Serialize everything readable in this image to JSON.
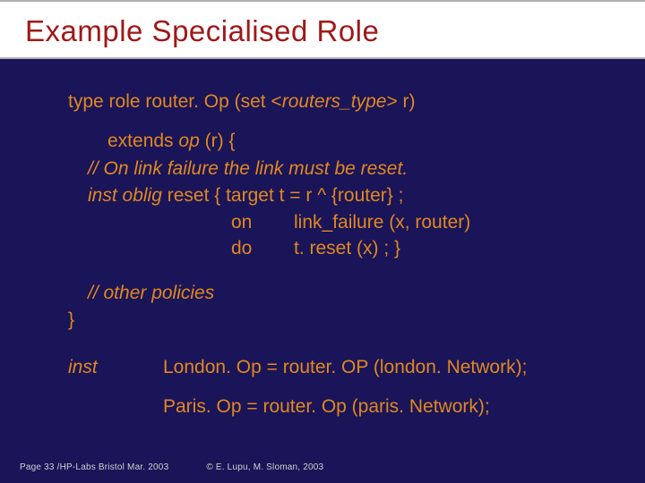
{
  "title": "Example Specialised Role",
  "lines": {
    "decl_pre": "type role router. Op (set <",
    "decl_rt": "routers_type",
    "decl_post": "> r)",
    "extends": "extends ",
    "extends_op": "op ",
    "extends_rest": "(r) {",
    "comment1": "// On link failure the link  must be  reset.",
    "inst": "inst oblig ",
    "reset": "reset { ",
    "target": "target",
    "teq": "  t = r ^ {router} ;",
    "on": "on",
    "on_rhs": "link_failure (x, router)",
    "do": "do",
    "do_rhs": "t. reset (x) ; }",
    "comment2": "// other policies",
    "close": "}",
    "inst_lbl": "inst",
    "london": "London. Op = router. OP (london. Network);",
    "paris": "Paris. Op  = router. Op (paris. Network);"
  },
  "footer": {
    "left": "Page 33 /HP-Labs Bristol Mar. 2003",
    "right": "© E. Lupu, M. Sloman, 2003"
  }
}
